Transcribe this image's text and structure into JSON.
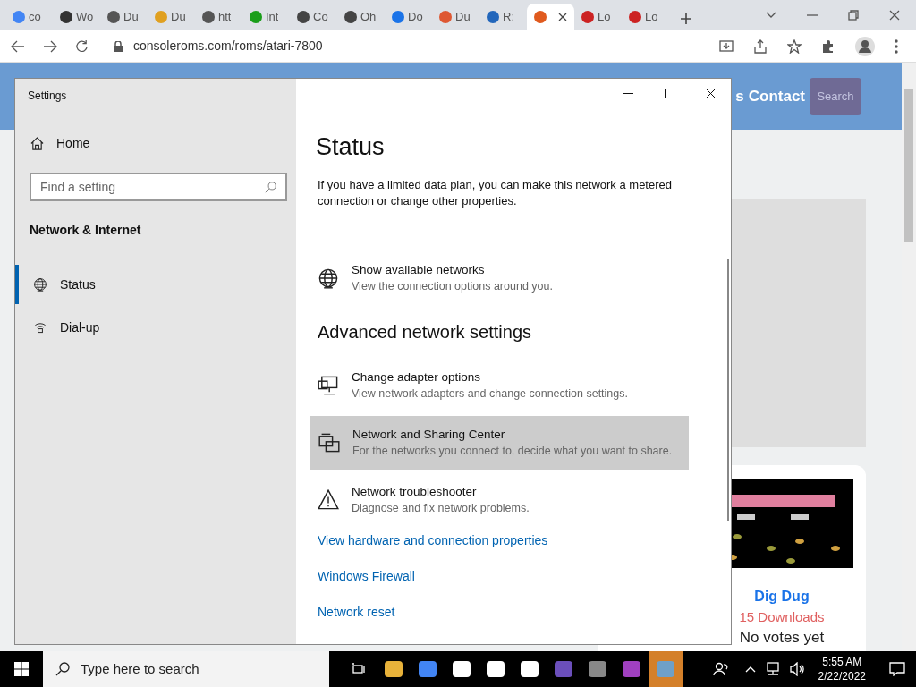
{
  "browser": {
    "tabs": [
      {
        "label": "co",
        "color": "#4285f4",
        "selected": false
      },
      {
        "label": "Wo",
        "color": "#333333",
        "selected": false
      },
      {
        "label": "Du",
        "color": "#555555",
        "selected": false
      },
      {
        "label": "Du",
        "color": "#e0a020",
        "selected": false
      },
      {
        "label": "htt",
        "color": "#555555",
        "selected": false
      },
      {
        "label": "Int",
        "color": "#1a9e1a",
        "selected": false
      },
      {
        "label": "Co",
        "color": "#444444",
        "selected": false
      },
      {
        "label": "Oh",
        "color": "#444444",
        "selected": false
      },
      {
        "label": "Do",
        "color": "#1a73e8",
        "selected": false
      },
      {
        "label": "Du",
        "color": "#de5833",
        "selected": false
      },
      {
        "label": "R:",
        "color": "#2266bb",
        "selected": false
      },
      {
        "color": "#e05a1e",
        "selected": true
      },
      {
        "label": "Lo",
        "color": "#cc2222",
        "selected": false
      },
      {
        "label": "Lo",
        "color": "#cc2222",
        "selected": false
      }
    ],
    "url": "consoleroms.com/roms/atari-7800"
  },
  "webpage": {
    "nav_partial": "s",
    "nav_contact": "Contact",
    "search_button": "Search",
    "card": {
      "title": "Dig Dug",
      "downloads": "15 Downloads",
      "votes": "No votes yet"
    }
  },
  "settings": {
    "window_title": "Settings",
    "home": "Home",
    "search_placeholder": "Find a setting",
    "section": "Network & Internet",
    "nav": [
      {
        "label": "Status",
        "kind": "globe",
        "selected": true
      },
      {
        "label": "Dial-up",
        "kind": "dialup",
        "selected": false
      }
    ],
    "heading": "Status",
    "intro": "If you have a limited data plan, you can make this network a metered connection or change other properties.",
    "rows_top": [
      {
        "kind": "globe",
        "title": "Show available networks",
        "desc": "View the connection options around you.",
        "hovered": false
      }
    ],
    "subheading": "Advanced network settings",
    "rows": [
      {
        "kind": "monitor",
        "title": "Change adapter options",
        "desc": "View network adapters and change connection settings.",
        "hovered": false
      },
      {
        "kind": "sharing",
        "title": "Network and Sharing Center",
        "desc": "For the networks you connect to, decide what you want to share.",
        "hovered": true
      },
      {
        "kind": "warning",
        "title": "Network troubleshooter",
        "desc": "Diagnose and fix network problems.",
        "hovered": false
      }
    ],
    "links": [
      "View hardware and connection properties",
      "Windows Firewall",
      "Network reset"
    ]
  },
  "taskbar": {
    "search_placeholder": "Type here to search",
    "time": "5:55 AM",
    "date": "2/22/2022"
  }
}
